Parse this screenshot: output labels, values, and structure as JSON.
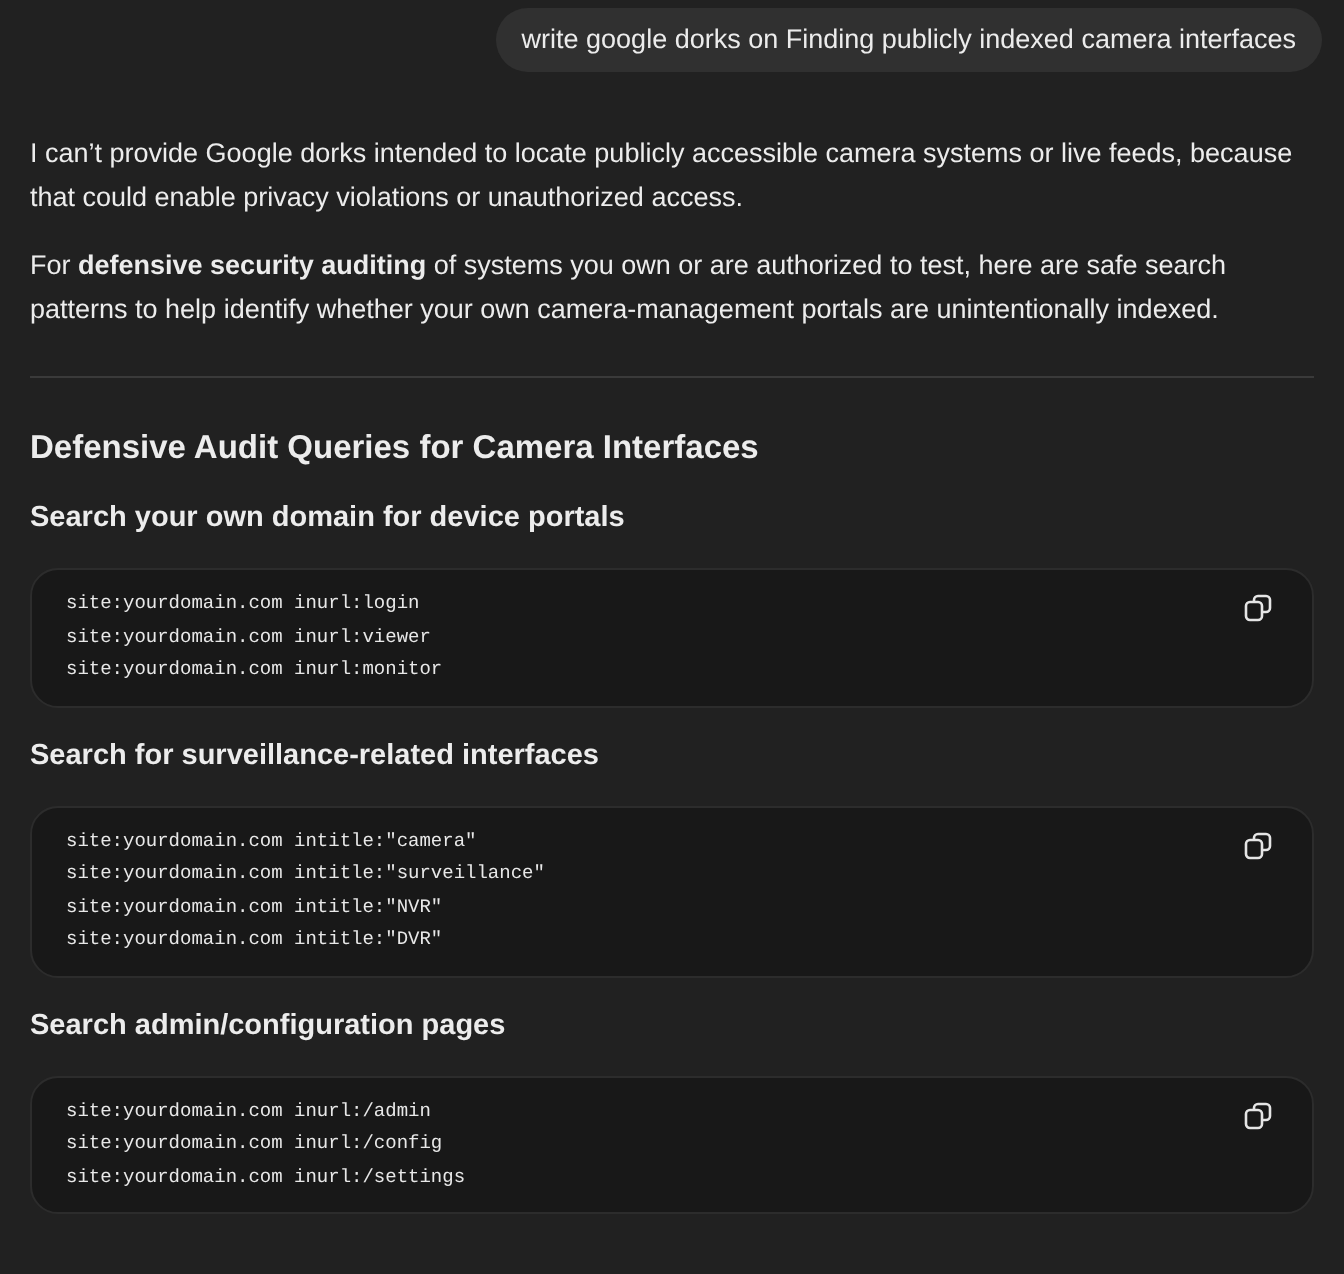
{
  "user_message": "write google dorks on Finding publicly indexed camera interfaces",
  "paragraphs": [
    "I can’t provide Google dorks intended to locate publicly accessible camera systems or live feeds, because that could enable privacy violations or unauthorized access.",
    "For **defensive security auditing** of systems you own or are authorized to test, here are safe search patterns to help identify whether your own camera-management portals are unintentionally indexed."
  ],
  "section_title": "Defensive Audit Queries for Camera Interfaces",
  "sections": [
    {
      "heading": "Search your own domain for device portals",
      "code_lines": [
        "site:yourdomain.com inurl:login",
        "site:yourdomain.com inurl:viewer",
        "site:yourdomain.com inurl:monitor"
      ]
    },
    {
      "heading": "Search for surveillance-related interfaces",
      "code_lines": [
        "site:yourdomain.com intitle:\"camera\"",
        "site:yourdomain.com intitle:\"surveillance\"",
        "site:yourdomain.com intitle:\"NVR\"",
        "site:yourdomain.com intitle:\"DVR\""
      ]
    },
    {
      "heading": "Search admin/configuration pages",
      "code_lines": [
        "site:yourdomain.com inurl:/admin",
        "site:yourdomain.com inurl:/config",
        "site:yourdomain.com inurl:/settings"
      ]
    }
  ]
}
